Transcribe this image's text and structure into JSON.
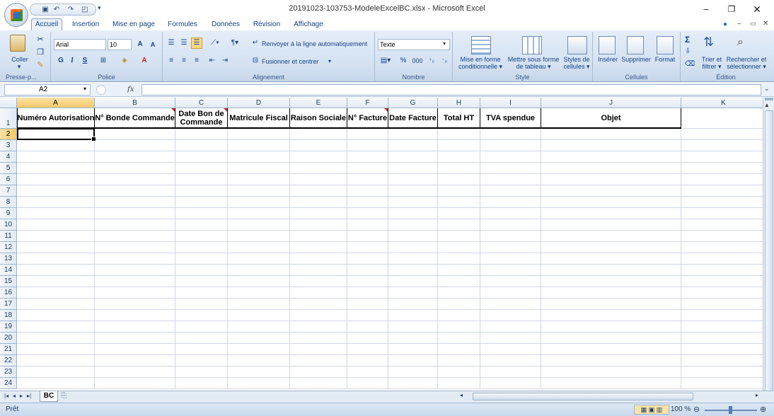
{
  "window": {
    "title": "20191023-103753-ModeleExcelBC.xlsx - Microsoft Excel"
  },
  "tabs": [
    "Accueil",
    "Insertion",
    "Mise en page",
    "Formules",
    "Données",
    "Révision",
    "Affichage"
  ],
  "ribbon": {
    "clipboard": {
      "paste": "Coller",
      "label": "Presse-p..."
    },
    "font": {
      "name": "Arial",
      "size": "10",
      "bold": "G",
      "italic": "I",
      "underline": "S",
      "label": "Police"
    },
    "alignment": {
      "wrap": "Renvoyer à la ligne automatiquement",
      "merge": "Fusionner et centrer",
      "label": "Alignement"
    },
    "number": {
      "format": "Texte",
      "percent": "%",
      "thousands": "000",
      "label": "Nombre"
    },
    "style": {
      "cond1": "Mise en forme",
      "cond2": "conditionnelle",
      "table1": "Mettre sous forme",
      "table2": "de tableau",
      "cell1": "Styles de",
      "cell2": "cellules",
      "label": "Style"
    },
    "cells": {
      "insert": "Insérer",
      "delete": "Supprimer",
      "format": "Format",
      "label": "Cellules"
    },
    "editing": {
      "sort1": "Trier et",
      "sort2": "filtrer",
      "find1": "Rechercher et",
      "find2": "sélectionner",
      "label": "Édition"
    }
  },
  "formula_bar": {
    "name_box": "A2",
    "fx": "fx",
    "formula": ""
  },
  "columns": [
    "A",
    "B",
    "C",
    "D",
    "E",
    "F",
    "G",
    "H",
    "I",
    "J",
    "K"
  ],
  "rows": [
    "1",
    "2",
    "3",
    "4",
    "5",
    "6",
    "7",
    "8",
    "9",
    "10",
    "11",
    "12",
    "13",
    "14",
    "15",
    "16",
    "17",
    "18",
    "19",
    "20",
    "21",
    "22",
    "23",
    "24"
  ],
  "headers": [
    "Numéro Autorisation",
    "N° Bonde Commande",
    "Date Bon de Commande",
    "Matricule Fiscal",
    "Raison Sociale",
    "N° Facture",
    "Date Facture",
    "Total HT",
    "TVA spendue",
    "Objet"
  ],
  "sheet_tab": "BC",
  "status": {
    "ready": "Prêt",
    "zoom": "100 %"
  }
}
